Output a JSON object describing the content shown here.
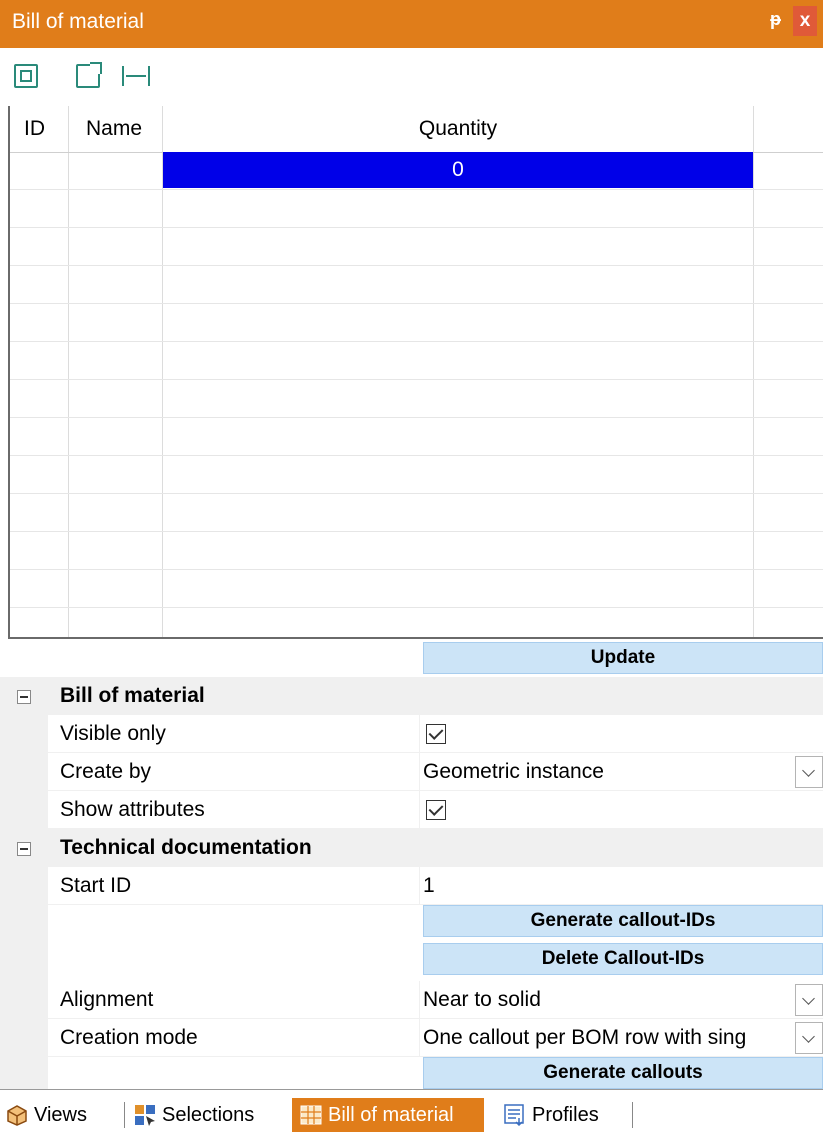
{
  "window": {
    "title": "Bill of material",
    "pin_glyph": "ᵽ",
    "close_glyph": "x"
  },
  "toolbar": {
    "icons": [
      "copy-icon",
      "export-icon",
      "fit-width-icon"
    ]
  },
  "grid": {
    "columns": [
      "ID",
      "Name",
      "Quantity"
    ],
    "selected_cell_value": "0"
  },
  "update_button": "Update",
  "bill_of_material": {
    "title": "Bill of material",
    "visible_only_label": "Visible only",
    "visible_only_checked": true,
    "create_by_label": "Create by",
    "create_by_value": "Geometric instance",
    "show_attributes_label": "Show attributes",
    "show_attributes_checked": true
  },
  "technical_documentation": {
    "title": "Technical documentation",
    "start_id_label": "Start ID",
    "start_id_value": "1",
    "generate_callout_ids_button": "Generate callout-IDs",
    "delete_callout_ids_button": "Delete Callout-IDs",
    "alignment_label": "Alignment",
    "alignment_value": "Near to solid",
    "creation_mode_label": "Creation mode",
    "creation_mode_value": "One callout per BOM row with sing",
    "generate_callouts_button": "Generate callouts"
  },
  "tabs": [
    {
      "label": "Views",
      "active": false
    },
    {
      "label": "Selections",
      "active": false
    },
    {
      "label": "Bill of material",
      "active": true
    },
    {
      "label": "Profiles",
      "active": false
    }
  ],
  "colors": {
    "accent": "#e07d1a",
    "selection": "#0000e8",
    "button": "#cce4f7"
  }
}
